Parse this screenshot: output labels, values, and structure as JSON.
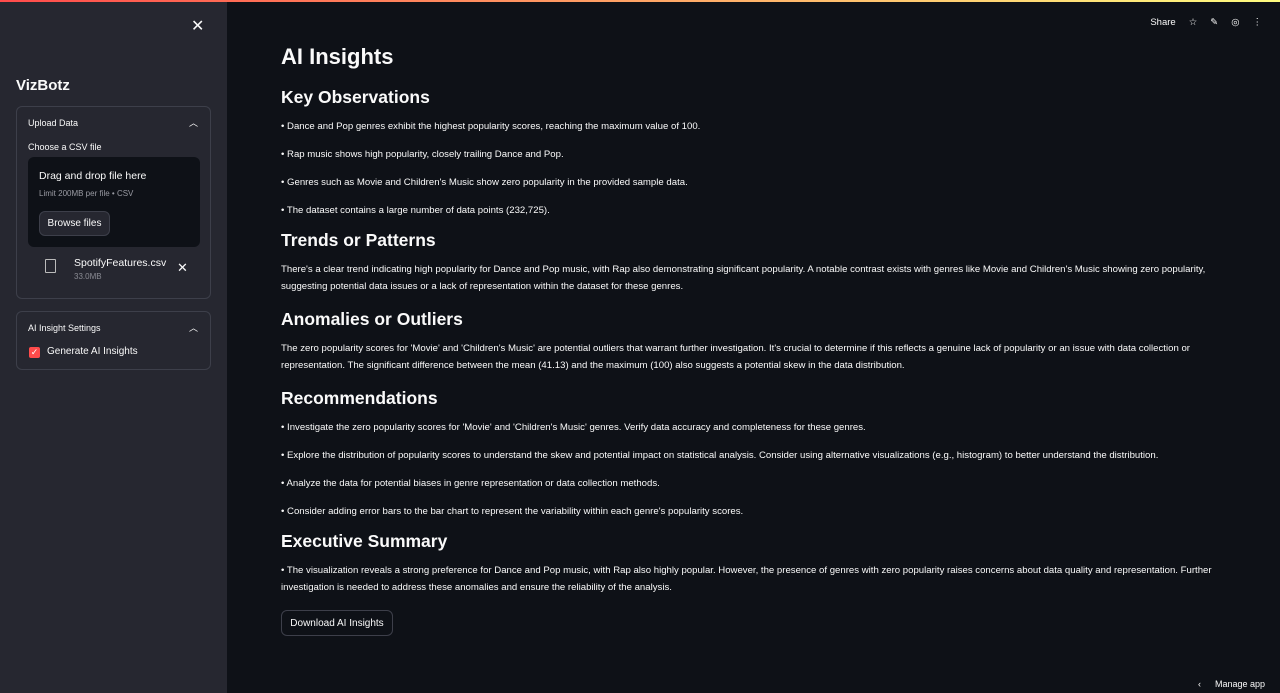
{
  "sidebar": {
    "title": "VizBotz",
    "upload": {
      "title": "Upload Data",
      "label": "Choose a CSV file",
      "drop_text": "Drag and drop file here",
      "limit": "Limit 200MB per file • CSV",
      "browse": "Browse files",
      "file_name": "SpotifyFeatures.csv",
      "file_size": "33.0MB"
    },
    "settings": {
      "title": "AI Insight Settings",
      "checkbox_label": "Generate AI Insights",
      "checked": true
    }
  },
  "toolbar": {
    "share": "Share"
  },
  "main": {
    "title": "AI Insights",
    "sections": [
      {
        "heading": "Key Observations",
        "bullets": [
          "• Dance and Pop genres exhibit the highest popularity scores, reaching the maximum value of 100.",
          "• Rap music shows high popularity, closely trailing Dance and Pop.",
          "• Genres such as Movie and Children's Music show zero popularity in the provided sample data.",
          "• The dataset contains a large number of data points (232,725)."
        ]
      },
      {
        "heading": "Trends or Patterns",
        "text": "There's a clear trend indicating high popularity for Dance and Pop music, with Rap also demonstrating significant popularity. A notable contrast exists with genres like Movie and Children's Music showing zero popularity, suggesting potential data issues or a lack of representation within the dataset for these genres."
      },
      {
        "heading": "Anomalies or Outliers",
        "text": "The zero popularity scores for 'Movie' and 'Children's Music' are potential outliers that warrant further investigation. It's crucial to determine if this reflects a genuine lack of popularity or an issue with data collection or representation. The significant difference between the mean (41.13) and the maximum (100) also suggests a potential skew in the data distribution."
      },
      {
        "heading": "Recommendations",
        "bullets": [
          "• Investigate the zero popularity scores for 'Movie' and 'Children's Music' genres. Verify data accuracy and completeness for these genres.",
          "• Explore the distribution of popularity scores to understand the skew and potential impact on statistical analysis. Consider using alternative visualizations (e.g., histogram) to better understand the distribution.",
          "• Analyze the data for potential biases in genre representation or data collection methods.",
          "• Consider adding error bars to the bar chart to represent the variability within each genre's popularity scores."
        ]
      },
      {
        "heading": "Executive Summary",
        "text": "• The visualization reveals a strong preference for Dance and Pop music, with Rap also highly popular. However, the presence of genres with zero popularity raises concerns about data quality and representation. Further investigation is needed to address these anomalies and ensure the reliability of the analysis."
      }
    ],
    "download": "Download AI Insights"
  },
  "footer": {
    "manage": "Manage app"
  }
}
